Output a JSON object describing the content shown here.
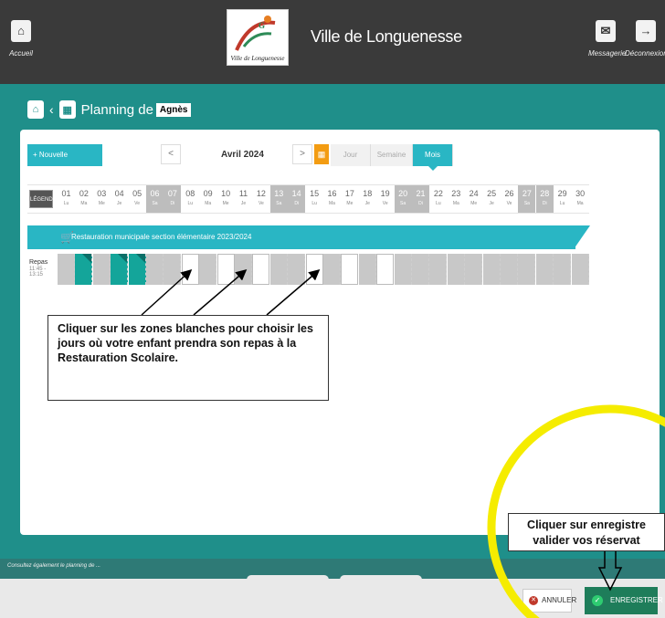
{
  "topbar": {
    "home_label": "Accueil",
    "city_name": "Ville de Longuenesse",
    "messaging_label": "Messagerie",
    "logout_label": "Déconnexion",
    "logo_text": "Ville de Longuenesse"
  },
  "planning": {
    "title": "Planning de",
    "child_name": "Agnès"
  },
  "toolbar": {
    "new_registration": "Nouvelle inscription",
    "prev": "<",
    "next": ">",
    "month": "Avril 2024",
    "views": [
      "Jour",
      "Semaine",
      "Mois"
    ],
    "active_view": "Mois"
  },
  "calendar": {
    "legend_label": "LÉGENDE",
    "days": [
      {
        "n": "01",
        "w": "Lu",
        "type": "work"
      },
      {
        "n": "02",
        "w": "Ma",
        "type": "work"
      },
      {
        "n": "03",
        "w": "Me",
        "type": "work"
      },
      {
        "n": "04",
        "w": "Je",
        "type": "work"
      },
      {
        "n": "05",
        "w": "Ve",
        "type": "work"
      },
      {
        "n": "06",
        "w": "Sa",
        "type": "weekend"
      },
      {
        "n": "07",
        "w": "Di",
        "type": "weekend"
      },
      {
        "n": "08",
        "w": "Lu",
        "type": "work"
      },
      {
        "n": "09",
        "w": "Ma",
        "type": "work"
      },
      {
        "n": "10",
        "w": "Me",
        "type": "work"
      },
      {
        "n": "11",
        "w": "Je",
        "type": "work"
      },
      {
        "n": "12",
        "w": "Ve",
        "type": "work"
      },
      {
        "n": "13",
        "w": "Sa",
        "type": "weekend"
      },
      {
        "n": "14",
        "w": "Di",
        "type": "weekend"
      },
      {
        "n": "15",
        "w": "Lu",
        "type": "work"
      },
      {
        "n": "16",
        "w": "Ma",
        "type": "work"
      },
      {
        "n": "17",
        "w": "Me",
        "type": "work"
      },
      {
        "n": "18",
        "w": "Je",
        "type": "work"
      },
      {
        "n": "19",
        "w": "Ve",
        "type": "work"
      },
      {
        "n": "20",
        "w": "Sa",
        "type": "weekend"
      },
      {
        "n": "21",
        "w": "Di",
        "type": "weekend"
      },
      {
        "n": "22",
        "w": "Lu",
        "type": "work"
      },
      {
        "n": "23",
        "w": "Ma",
        "type": "work"
      },
      {
        "n": "24",
        "w": "Me",
        "type": "work"
      },
      {
        "n": "25",
        "w": "Je",
        "type": "work"
      },
      {
        "n": "26",
        "w": "Ve",
        "type": "work"
      },
      {
        "n": "27",
        "w": "Sa",
        "type": "weekend"
      },
      {
        "n": "28",
        "w": "Di",
        "type": "weekend"
      },
      {
        "n": "29",
        "w": "Lu",
        "type": "work"
      },
      {
        "n": "30",
        "w": "Ma",
        "type": "work"
      }
    ],
    "service_name": "Restauration municipale section élémentaire 2023/2024",
    "row_label": "Repas",
    "row_time": "11:45 - 13:15",
    "cells": [
      "grey",
      "teal",
      "grey",
      "teal",
      "teal",
      "grey",
      "grey",
      "white",
      "grey",
      "white",
      "grey",
      "white",
      "grey",
      "grey",
      "white",
      "grey",
      "white",
      "grey",
      "white",
      "grey",
      "grey",
      "grey",
      "grey",
      "grey",
      "grey",
      "grey",
      "grey",
      "grey",
      "grey",
      "grey"
    ]
  },
  "annotations": {
    "callout_main": "Cliquer sur les zones blanches pour choisir les jours où votre enfant prendra son repas à la Restauration Scolaire.",
    "callout_save_line1": "Cliquer sur enregistre",
    "callout_save_line2": "valider vos réservat"
  },
  "footer": {
    "note": "Consultez également le planning de ...",
    "cancel_label": "ANNULER",
    "save_label": "ENREGISTRER"
  },
  "colors": {
    "teal_dark": "#1f8f8a",
    "teal_light": "#29b6c4",
    "highlight_circle": "#f5ec00",
    "save_green": "#1e7d5a"
  }
}
